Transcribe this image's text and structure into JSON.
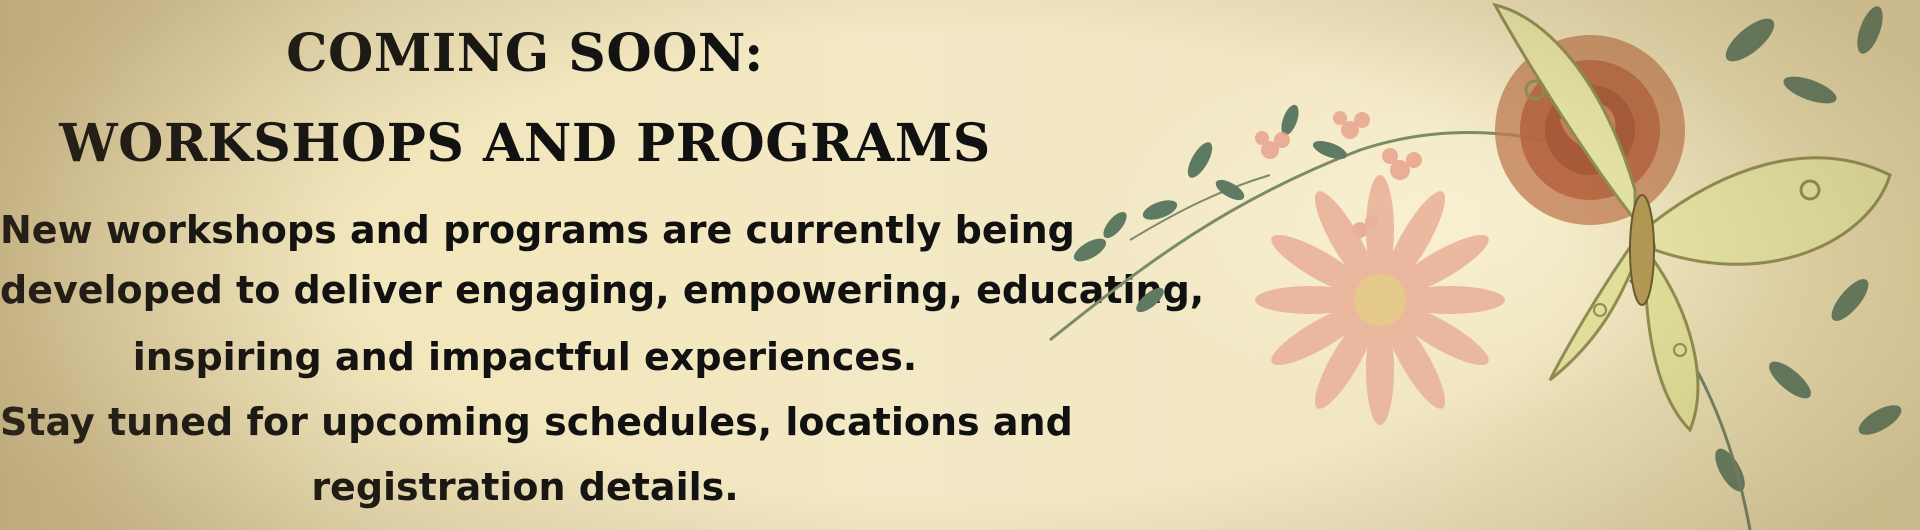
{
  "heading": {
    "line1": "COMING SOON:",
    "line2": "WORKSHOPS AND PROGRAMS"
  },
  "body": {
    "lines": [
      "New workshops and programs are currently being",
      "developed to deliver engaging, empowering, educating,",
      "inspiring and impactful experiences.",
      "Stay tuned for upcoming schedules, locations and",
      "registration details."
    ]
  },
  "colors": {
    "background": "#f1e6c2",
    "text": "#111111",
    "butterfly": "#e8e7a8",
    "flower_pink": "#e8a48e",
    "rose": "#b5643e",
    "leaf": "#5f7a62"
  }
}
